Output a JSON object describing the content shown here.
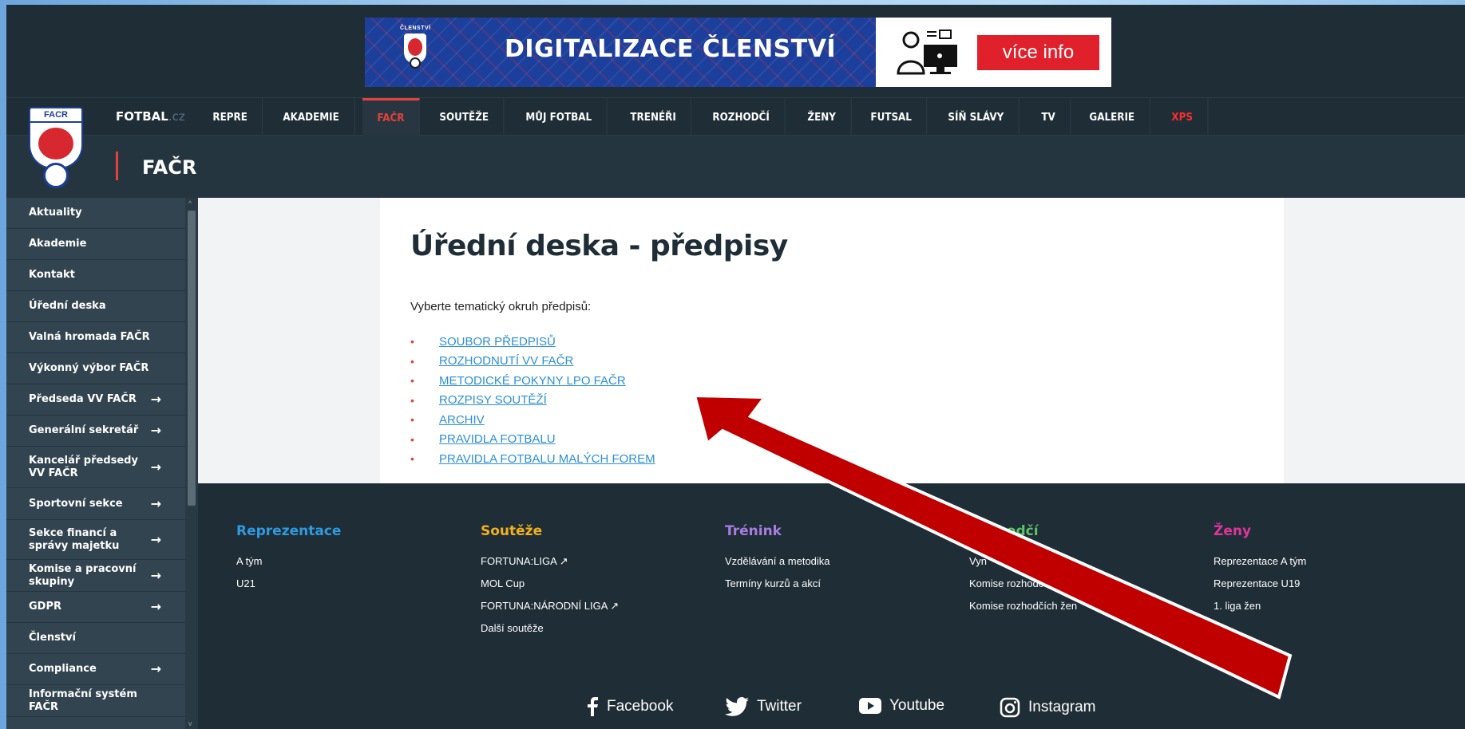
{
  "banner": {
    "logo_caption": "ČLENSTVÍ",
    "title": "DIGITALIZACE ČLENSTVÍ",
    "button": "více info"
  },
  "topnav": {
    "brand_main": "FOTBAL",
    "brand_suffix": ".cz",
    "items": [
      "REPRE",
      "AKADEMIE",
      "FAČR",
      "SOUTĚŽE",
      "MŮJ FOTBAL",
      "TRENÉŘI",
      "ROZHODČÍ",
      "ŽENY",
      "FUTSAL",
      "SÍŇ SLÁVY",
      "TV",
      "GALERIE",
      "XPS"
    ],
    "active": "FAČR",
    "accent_color": "#e2423b"
  },
  "logo_text": "FACR",
  "section_title": "FAČR",
  "sidebar": {
    "items": [
      {
        "label": "Aktuality",
        "arrow": ""
      },
      {
        "label": "Akademie",
        "arrow": ""
      },
      {
        "label": "Kontakt",
        "arrow": ""
      },
      {
        "label": "Úřední deska",
        "arrow": ""
      },
      {
        "label": "Valná hromada FAČR",
        "arrow": ""
      },
      {
        "label": "Výkonný výbor FAČR",
        "arrow": ""
      },
      {
        "label": "Předseda VV FAČR",
        "arrow": "→"
      },
      {
        "label": "Generální sekretář",
        "arrow": "→"
      },
      {
        "label": "Kancelář předsedy VV FAČR",
        "arrow": "→"
      },
      {
        "label": "Sportovní sekce",
        "arrow": "→"
      },
      {
        "label": "Sekce financí a správy majetku",
        "arrow": "→"
      },
      {
        "label": "Komise a pracovní skupiny",
        "arrow": "→"
      },
      {
        "label": "GDPR",
        "arrow": "→"
      },
      {
        "label": "Členství",
        "arrow": ""
      },
      {
        "label": "Compliance",
        "arrow": "→"
      },
      {
        "label": "Informační systém FAČR",
        "arrow": ""
      }
    ],
    "scroll_up": "^",
    "scroll_down": "v"
  },
  "main": {
    "title": "Úřední deska - předpisy",
    "intro": "Vyberte tematický okruh předpisů:",
    "bullet": "•",
    "links": [
      "SOUBOR PŘEDPISŮ",
      "ROZHODNUTÍ VV FAČR",
      "METODICKÉ POKYNY LPO FAČR",
      "ROZPISY SOUTĚŽÍ",
      "ARCHIV",
      "PRAVIDLA FOTBALU",
      "PRAVIDLA FOTBALU MALÝCH FOREM"
    ]
  },
  "footer": {
    "columns": [
      {
        "title": "Reprezentace",
        "color": "#2f9be0",
        "links": [
          "A tým",
          "U21"
        ]
      },
      {
        "title": "Soutěže",
        "color": "#f2b21d",
        "links": [
          "FORTUNA:LIGA ↗",
          "MOL Cup",
          "FORTUNA:NÁRODNÍ LIGA ↗",
          "Další soutěže"
        ]
      },
      {
        "title": "Trénink",
        "color": "#a87de0",
        "links": [
          "Vzdělávání a metodika",
          "Termíny kurzů a akcí"
        ]
      },
      {
        "title": "Rozhodčí",
        "color": "#5ec26a",
        "links": [
          "Vyn",
          "Komise rozhodčích",
          "Komise rozhodčích žen"
        ]
      },
      {
        "title": "Ženy",
        "color": "#e0359a",
        "links": [
          "Reprezentace A tým",
          "Reprezentace U19",
          "1. liga žen"
        ]
      }
    ],
    "social": [
      "Facebook",
      "Twitter",
      "Youtube",
      "Instagram"
    ]
  },
  "annotation": {
    "arrow_color": "#c00000"
  }
}
